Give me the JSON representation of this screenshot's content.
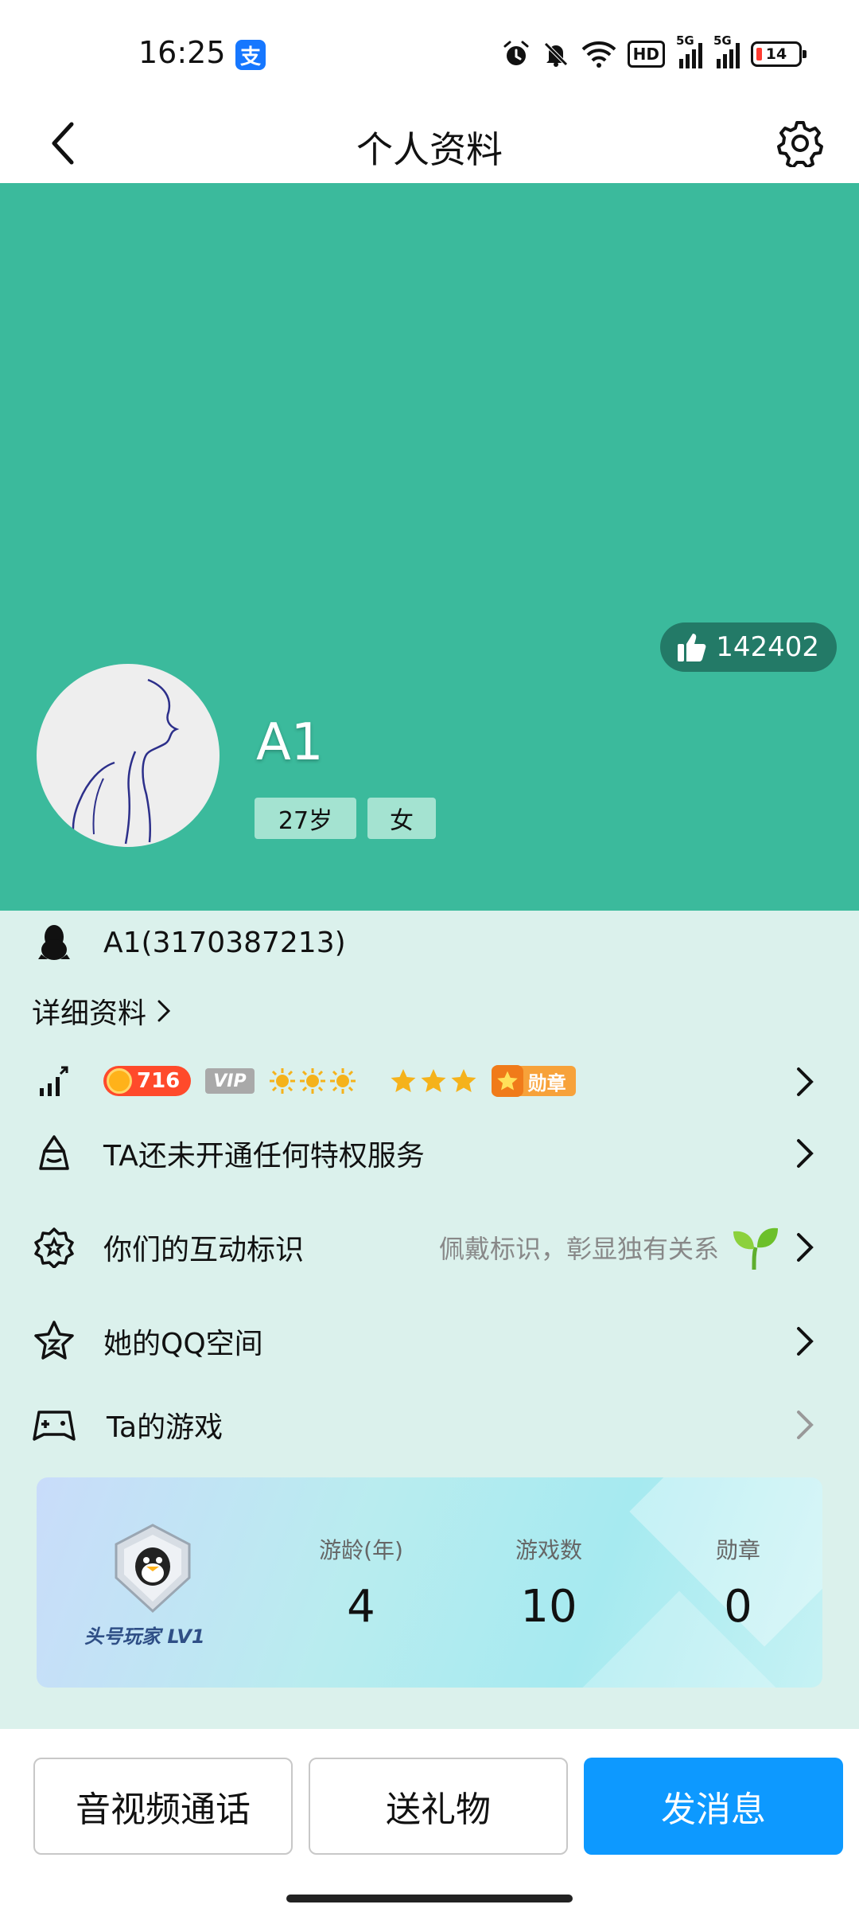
{
  "status_bar": {
    "time": "16:25",
    "alipay_badge": "支",
    "hd_label": "HD",
    "signal_1_label": "5G",
    "signal_2_label": "5G",
    "battery_level": "14"
  },
  "nav": {
    "title": "个人资料"
  },
  "cover": {
    "like_count": "142402",
    "nickname": "A1",
    "age_tag": "27岁",
    "gender_tag": "女",
    "background_color": "#3bba9c"
  },
  "info": {
    "qq_account": "A1(3170387213)",
    "detail_link": "详细资料",
    "coin_level": "716",
    "vip_label": "VIP",
    "medal_label": "勋章",
    "privilege_text": "TA还未开通任何特权服务",
    "interaction_label": "你们的互动标识",
    "interaction_hint": "佩戴标识，彰显独有关系",
    "qzone_label": "她的QQ空间",
    "games_label": "Ta的游戏"
  },
  "game_card": {
    "player_level": "头号玩家 LV1",
    "stats": [
      {
        "label": "游龄(年)",
        "value": "4"
      },
      {
        "label": "游戏数",
        "value": "10"
      },
      {
        "label": "勋章",
        "value": "0"
      }
    ]
  },
  "actions": {
    "call_label": "音视频通话",
    "gift_label": "送礼物",
    "message_label": "发消息",
    "primary_color": "#0d99ff"
  }
}
